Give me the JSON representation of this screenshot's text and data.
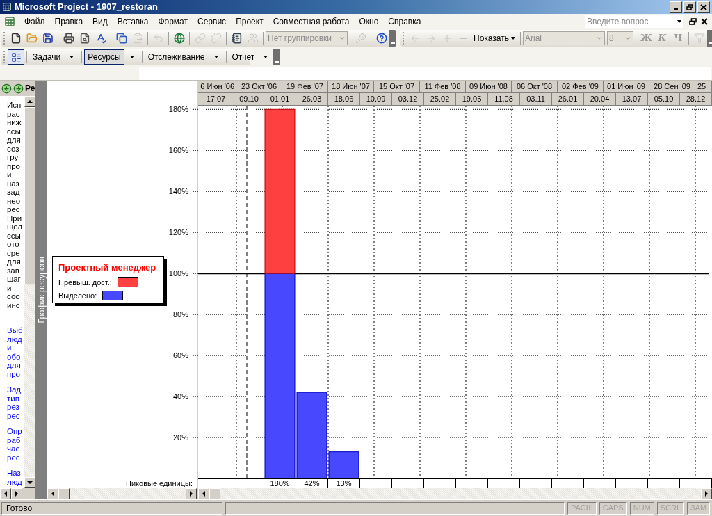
{
  "window": {
    "title": "Microsoft Project - 1907_restoran"
  },
  "menu": [
    "Файл",
    "Правка",
    "Вид",
    "Вставка",
    "Формат",
    "Сервис",
    "Проект",
    "Совместная работа",
    "Окно",
    "Справка"
  ],
  "ask_field": {
    "placeholder": "Введите вопрос"
  },
  "standard_toolbar": [
    {
      "kind": "new",
      "disabled": false
    },
    {
      "kind": "open",
      "disabled": false
    },
    {
      "kind": "save",
      "disabled": false
    },
    {
      "kind": "separator"
    },
    {
      "kind": "print",
      "disabled": false
    },
    {
      "kind": "preview",
      "disabled": false
    },
    {
      "kind": "spelling",
      "disabled": false
    },
    {
      "kind": "separator"
    },
    {
      "kind": "copy",
      "disabled": false
    },
    {
      "kind": "paste",
      "disabled": true
    },
    {
      "kind": "separator"
    },
    {
      "kind": "undo",
      "disabled": true
    },
    {
      "kind": "separator"
    },
    {
      "kind": "hyperlink",
      "disabled": false
    },
    {
      "kind": "separator"
    },
    {
      "kind": "link",
      "disabled": true
    },
    {
      "kind": "unlink",
      "disabled": true
    },
    {
      "kind": "separator"
    },
    {
      "kind": "notes",
      "disabled": false
    },
    {
      "kind": "assign",
      "disabled": true
    },
    {
      "kind": "separator"
    },
    {
      "kind": "group_dropdown",
      "value": "Нет группировки",
      "disabled": true
    },
    {
      "kind": "separator"
    },
    {
      "kind": "tools",
      "disabled": true
    },
    {
      "kind": "separator"
    },
    {
      "kind": "help",
      "disabled": false
    }
  ],
  "formatting_toolbar": [
    {
      "kind": "back",
      "disabled": true
    },
    {
      "kind": "forward",
      "disabled": true
    },
    {
      "kind": "expand",
      "disabled": true
    },
    {
      "kind": "collapse",
      "disabled": true
    },
    {
      "kind": "menu",
      "label": "Показать"
    },
    {
      "kind": "separator"
    },
    {
      "kind": "font_dropdown",
      "value": "Arial",
      "disabled": true
    },
    {
      "kind": "size_dropdown",
      "value": "8",
      "disabled": true
    },
    {
      "kind": "separator"
    },
    {
      "kind": "bold",
      "label": "Ж",
      "disabled": true
    },
    {
      "kind": "italic",
      "label": "К",
      "disabled": true
    },
    {
      "kind": "underline",
      "label": "Ч",
      "disabled": true
    },
    {
      "kind": "separator"
    },
    {
      "kind": "filter",
      "disabled": true
    }
  ],
  "guide_toolbar": [
    {
      "label": "Задачи",
      "selected": false
    },
    {
      "label": "Ресурсы",
      "selected": true
    },
    {
      "label": "Отслеживание",
      "selected": false
    },
    {
      "label": "Отчет",
      "selected": false
    }
  ],
  "side_pane": {
    "title": "Ре",
    "paragraphs": [
      {
        "kind": "text",
        "lines": [
          "Исп",
          "рас",
          "ниж",
          "ссы",
          "для",
          "соз",
          "гру",
          "про",
          "и",
          "наз",
          "зад",
          "нео",
          "рес",
          "При",
          "щел",
          "ссы",
          "ото",
          "сре",
          "для",
          "зав",
          "шаг",
          "и",
          "соо",
          "инс"
        ]
      },
      {
        "kind": "link",
        "lines": [
          "Выб",
          "люд",
          "и",
          "обо",
          "для",
          "про"
        ]
      },
      {
        "kind": "link",
        "lines": [
          "Зад",
          "тип",
          "рез",
          "рес"
        ]
      },
      {
        "kind": "link",
        "lines": [
          "Опр",
          "раб",
          "час",
          "рес"
        ]
      },
      {
        "kind": "link",
        "lines": [
          "Наз",
          "люд"
        ]
      }
    ]
  },
  "view_bar": {
    "label": "График ресурсов"
  },
  "graph": {
    "major_scale": [
      "6 Июн '06",
      "23 Окт '06",
      "19 Фев '07",
      "18 Июн '07",
      "15 Окт '07",
      "11 Фев '08",
      "09 Июн '08",
      "06 Окт '08",
      "02 Фев '09",
      "01 Июн '09",
      "28 Сен '09",
      "25"
    ],
    "peak_label": "Пиковые единицы:",
    "legend": {
      "title": "Проектный менеджер"
    },
    "chart_data": {
      "type": "bar",
      "stacked": true,
      "categories": [
        "17.07",
        "09.10",
        "01.01",
        "26.03",
        "18.06",
        "10.09",
        "03.12",
        "25.02",
        "19.05",
        "11.08",
        "03.11",
        "26.01",
        "20.04",
        "13.07",
        "05.10",
        "28.12"
      ],
      "series": [
        {
          "name": "Выделено:",
          "color": "#4848ff",
          "values": [
            null,
            null,
            100,
            42,
            13,
            null,
            null,
            null,
            null,
            null,
            null,
            null,
            null,
            null,
            null,
            null
          ]
        },
        {
          "name": "Превыш. дост.:",
          "color": "#ff4040",
          "values": [
            null,
            null,
            80,
            null,
            null,
            null,
            null,
            null,
            null,
            null,
            null,
            null,
            null,
            null,
            null,
            null
          ]
        }
      ],
      "value_labels": [
        null,
        null,
        "180%",
        "42%",
        "13%",
        null,
        null,
        null,
        null,
        null,
        null,
        null,
        null,
        null,
        null,
        null
      ],
      "legend": "left",
      "ylim": [
        0,
        194
      ],
      "grid": true,
      "yticks": [
        {
          "value": 20,
          "label": "20%"
        },
        {
          "value": 40,
          "label": "40%"
        },
        {
          "value": 60,
          "label": "60%"
        },
        {
          "value": 80,
          "label": "80%"
        },
        {
          "value": 100,
          "label": "100%"
        },
        {
          "value": 120,
          "label": "120%"
        },
        {
          "value": 140,
          "label": "140%"
        },
        {
          "value": 160,
          "label": "160%"
        },
        {
          "value": 180,
          "label": "180%"
        }
      ],
      "ref_lines": [
        {
          "axis": "y",
          "value": 100
        }
      ]
    }
  },
  "status_bar": {
    "text": "Готово",
    "indicators": [
      {
        "label": "РАСШ",
        "on": false
      },
      {
        "label": "CAPS",
        "on": false
      },
      {
        "label": "NUM",
        "on": false
      },
      {
        "label": "SCRL",
        "on": false
      },
      {
        "label": "ЗАМ",
        "on": false
      }
    ]
  }
}
